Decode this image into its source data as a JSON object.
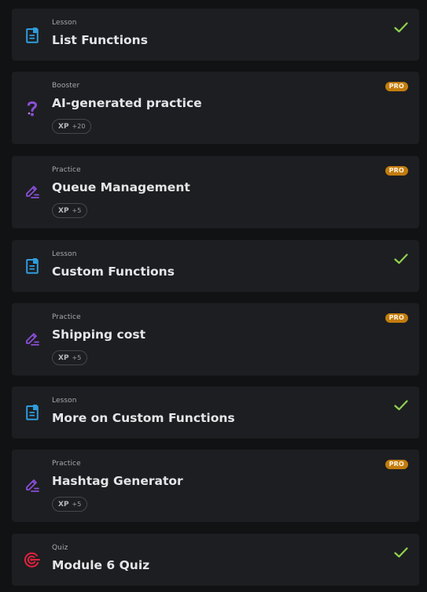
{
  "colors": {
    "lesson_icon": "#2f9cdc",
    "practice_icon": "#8a4fd8",
    "booster_icon": "#8a4fd8",
    "quiz_icon": "#e0223e",
    "check": "#8fd14f",
    "pro_badge": "#c27c0e"
  },
  "items": [
    {
      "type": "Lesson",
      "title": "List Functions",
      "icon": "lesson-doc-icon",
      "status": "completed"
    },
    {
      "type": "Booster",
      "title": "AI-generated practice",
      "icon": "question-mark-icon",
      "xp_label": "XP",
      "xp_value": "+20",
      "badge": "PRO"
    },
    {
      "type": "Practice",
      "title": "Queue Management",
      "icon": "pencil-icon",
      "xp_label": "XP",
      "xp_value": "+5",
      "badge": "PRO"
    },
    {
      "type": "Lesson",
      "title": "Custom Functions",
      "icon": "lesson-doc-icon",
      "status": "completed"
    },
    {
      "type": "Practice",
      "title": "Shipping cost",
      "icon": "pencil-icon",
      "xp_label": "XP",
      "xp_value": "+5",
      "badge": "PRO"
    },
    {
      "type": "Lesson",
      "title": "More on Custom Functions",
      "icon": "lesson-doc-icon",
      "status": "completed"
    },
    {
      "type": "Practice",
      "title": "Hashtag Generator",
      "icon": "pencil-icon",
      "xp_label": "XP",
      "xp_value": "+5",
      "badge": "PRO"
    },
    {
      "type": "Quiz",
      "title": "Module 6 Quiz",
      "icon": "target-icon",
      "status": "completed"
    }
  ]
}
